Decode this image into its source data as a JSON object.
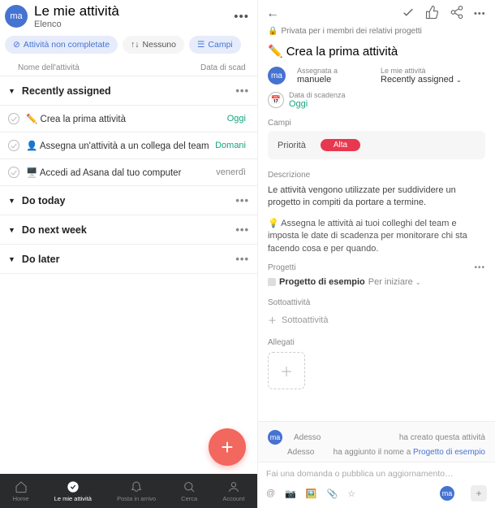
{
  "left": {
    "avatar_initials": "ma",
    "title": "Le mie attività",
    "subtitle": "Elenco",
    "chips": {
      "incomplete": "Attività non completate",
      "none": "Nessuno",
      "fields": "Campi"
    },
    "list_header": {
      "name": "Nome dell'attività",
      "date": "Data di scad"
    },
    "sections": {
      "recently_assigned": "Recently assigned",
      "do_today": "Do today",
      "do_next_week": "Do next week",
      "do_later": "Do later"
    },
    "tasks": [
      {
        "label": "✏️ Crea la prima attività",
        "date": "Oggi",
        "cls": "green"
      },
      {
        "label": "👤 Assegna un'attività a un collega del team",
        "date": "Domani",
        "cls": "green"
      },
      {
        "label": "🖥️ Accedi ad Asana dal tuo computer",
        "date": "venerdì",
        "cls": "gray"
      }
    ],
    "nav": {
      "home": "Home",
      "mytasks": "Le mie attività",
      "inbox": "Posta in arrivo",
      "search": "Cerca",
      "account": "Account"
    }
  },
  "right": {
    "privacy": "Privata per i membri dei relativi progetti",
    "title": "Crea la prima attività",
    "assignee_label": "Assegnata a",
    "assignee": "manuele",
    "mytasks_label": "Le mie attività",
    "section_val": "Recently assigned",
    "due_label": "Data di scadenza",
    "due_val": "Oggi",
    "fields_label": "Campi",
    "priority_label": "Priorità",
    "priority_val": "Alta",
    "desc_label": "Descrizione",
    "desc1": "Le attività vengono utilizzate per suddividere un progetto in compiti da portare a termine.",
    "desc2": "💡 Assegna le attività ai tuoi colleghi del team e imposta le date di scadenza per monitorare chi sta facendo cosa e per quando.",
    "projects_label": "Progetti",
    "project_name": "Progetto di esempio",
    "project_hint": "Per iniziare",
    "subtasks_label": "Sottoattività",
    "subtasks_add": "Sottoattività",
    "attach_label": "Allegati",
    "activity": {
      "time": "Adesso",
      "created": "ha creato questa attività",
      "added_prefix": "ha aggiunto il nome a ",
      "added_link": "Progetto di esempio"
    },
    "comment_placeholder": "Fai una domanda o pubblica un aggiornamento…"
  }
}
